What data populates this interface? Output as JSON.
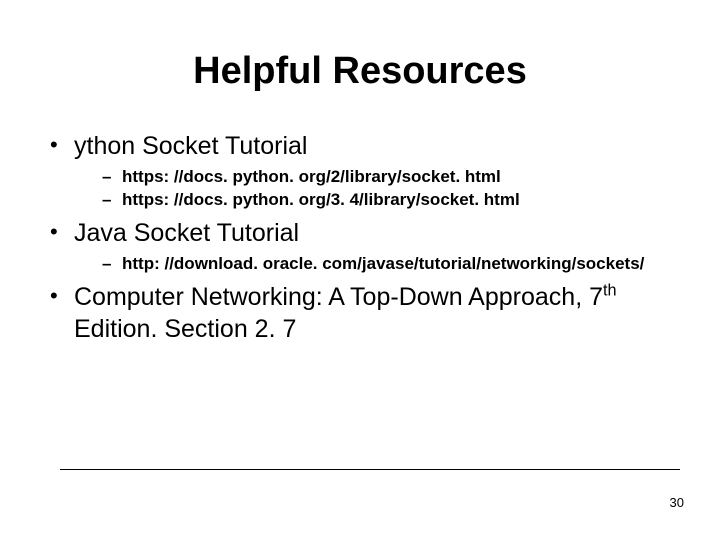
{
  "slide": {
    "title": "Helpful Resources",
    "bullets": {
      "b0": {
        "text": "ython Socket Tutorial",
        "sub": {
          "s0": "https: //docs. python. org/2/library/socket. html",
          "s1": "https: //docs. python. org/3. 4/library/socket. html"
        }
      },
      "b1": {
        "text": "Java Socket Tutorial",
        "sub": {
          "s0": "http: //download. oracle. com/javase/tutorial/networking/sockets/"
        }
      },
      "b2": {
        "text_pre": "Computer Networking: A Top-Down Approach, 7",
        "ord_suffix": "th",
        "text_post": " Edition. Section 2. 7"
      }
    },
    "page_number": "30"
  }
}
